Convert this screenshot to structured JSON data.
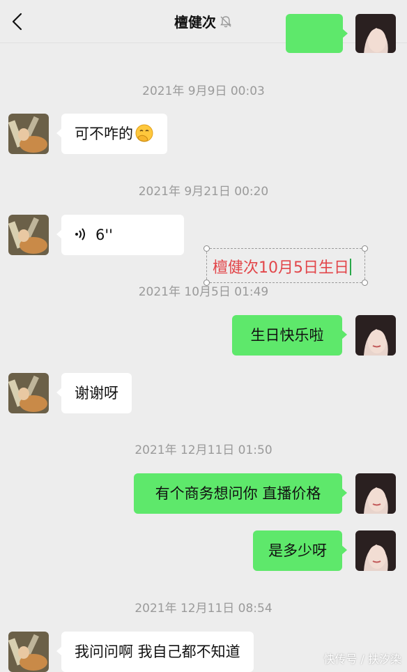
{
  "header": {
    "title": "檀健次",
    "back_icon": "chevron-left-icon",
    "mute_icon": "bell-off-icon",
    "more_icon": "ellipsis-icon"
  },
  "timestamps": [
    "2021年 9月9日 00:03",
    "2021年 9月21日 00:20",
    "2021年 10月5日 01:49",
    "2021年 12月11日 01:50",
    "2021年 12月11日 08:54"
  ],
  "messages": [
    {
      "side": "left",
      "text": "可不咋的",
      "emoji": "hand-over-mouth-emoji"
    },
    {
      "side": "left",
      "text": "6''",
      "type": "voice",
      "icon": "voice-wave-icon"
    },
    {
      "side": "right",
      "text": "生日快乐啦"
    },
    {
      "side": "left",
      "text": "谢谢呀"
    },
    {
      "side": "right",
      "text": "有个商务想问你 直播价格"
    },
    {
      "side": "right",
      "text": "是多少呀"
    },
    {
      "side": "left",
      "text": "我问问啊 我自己都不知道"
    }
  ],
  "annotation": {
    "text": "檀健次10月5日生日",
    "color": "#e2464a"
  },
  "watermark": "快传号 / 扶汐染",
  "colors": {
    "background": "#ededed",
    "bubble_left": "#ffffff",
    "bubble_right": "#5ee86b"
  }
}
